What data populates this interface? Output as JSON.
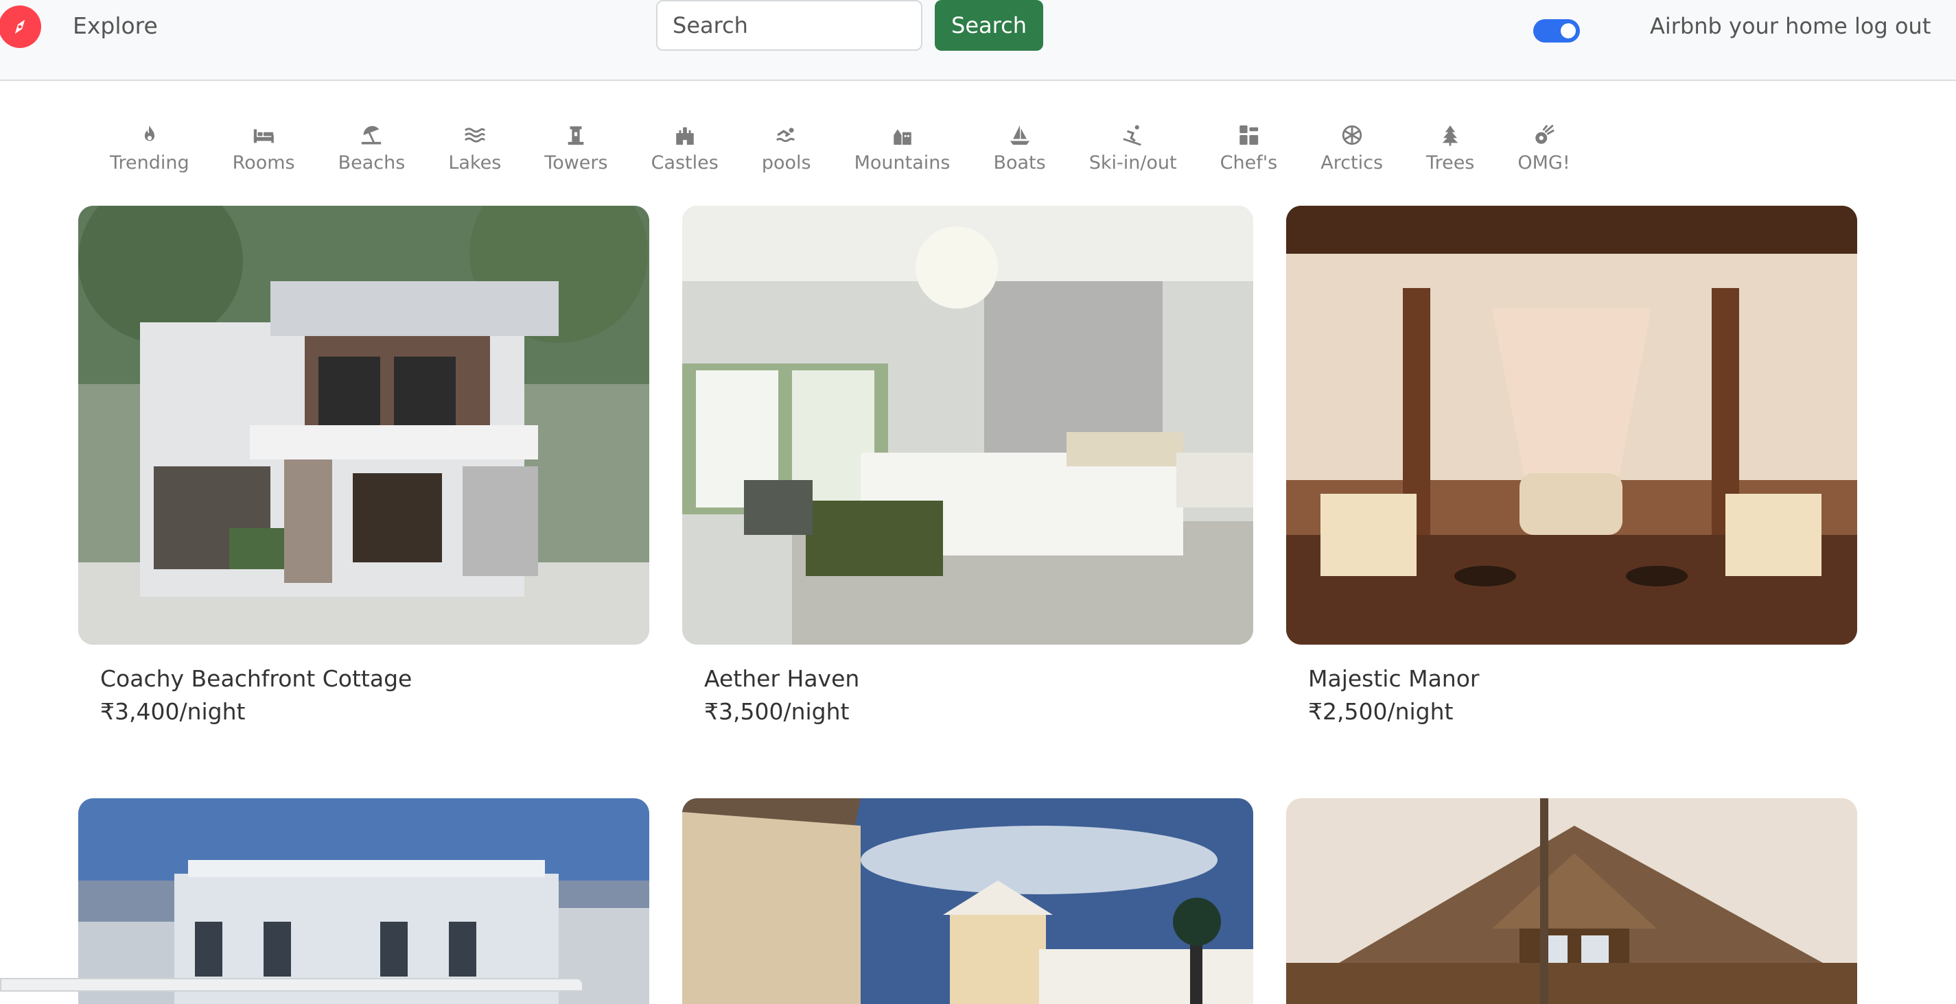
{
  "navbar": {
    "explore_label": "Explore",
    "search_placeholder": "Search",
    "search_button": "Search",
    "host_label": "Airbnb your home",
    "logout_label": "log out",
    "brand_color": "#fe424d",
    "search_button_color": "#2f7d49",
    "toggle_color": "#2e6ff0",
    "toggle_on": true
  },
  "filters": [
    {
      "label": "Trending",
      "icon": "fire-icon"
    },
    {
      "label": "Rooms",
      "icon": "bed-icon"
    },
    {
      "label": "Beachs",
      "icon": "umbrella-beach-icon"
    },
    {
      "label": "Lakes",
      "icon": "water-icon"
    },
    {
      "label": "Towers",
      "icon": "tower-icon"
    },
    {
      "label": "Castles",
      "icon": "castle-icon"
    },
    {
      "label": "pools",
      "icon": "swimmer-icon"
    },
    {
      "label": "Mountains",
      "icon": "mountain-city-icon"
    },
    {
      "label": "Boats",
      "icon": "sailboat-icon"
    },
    {
      "label": "Ski-in/out",
      "icon": "skier-icon"
    },
    {
      "label": "Chef's",
      "icon": "kitchen-icon"
    },
    {
      "label": "Arctics",
      "icon": "snowflake-icon"
    },
    {
      "label": "Trees",
      "icon": "tree-icon"
    },
    {
      "label": "OMG!",
      "icon": "meteor-icon"
    }
  ],
  "listings": [
    {
      "title": "Coachy Beachfront Cottage",
      "price": "₹3,400/night"
    },
    {
      "title": "Aether Haven",
      "price": "₹3,500/night"
    },
    {
      "title": "Majestic Manor",
      "price": "₹2,500/night"
    },
    {
      "title": "",
      "price": ""
    },
    {
      "title": "",
      "price": ""
    },
    {
      "title": "",
      "price": ""
    }
  ]
}
